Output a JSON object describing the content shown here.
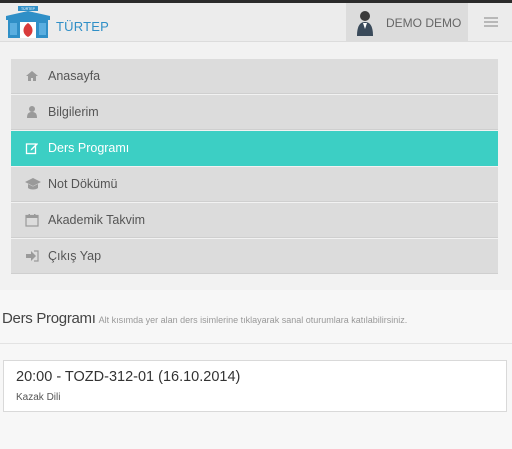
{
  "header": {
    "brand": "TÜRTEP",
    "logo_text": "TÜRTEP",
    "user_name": "DEMO DEMO"
  },
  "menu": {
    "items": [
      {
        "label": "Anasayfa",
        "icon": "home-icon"
      },
      {
        "label": "Bilgilerim",
        "icon": "user-icon"
      },
      {
        "label": "Ders Programı",
        "icon": "edit-icon",
        "active": true
      },
      {
        "label": "Not Dökümü",
        "icon": "graduation-cap-icon"
      },
      {
        "label": "Akademik Takvim",
        "icon": "calendar-icon"
      },
      {
        "label": "Çıkış Yap",
        "icon": "sign-out-icon"
      }
    ]
  },
  "page": {
    "title": "Ders Programı",
    "description": "Alt kısımda yer alan ders isimlerine tıklayarak sanal oturumlara katılabilirsiniz."
  },
  "courses": [
    {
      "title": "20:00 - TOZD-312-01 (16.10.2014)",
      "subtitle": "Kazak Dili"
    }
  ],
  "colors": {
    "accent": "#3ccfc4",
    "brand": "#2f8fc7",
    "menu_bg": "#dcdcdc"
  }
}
